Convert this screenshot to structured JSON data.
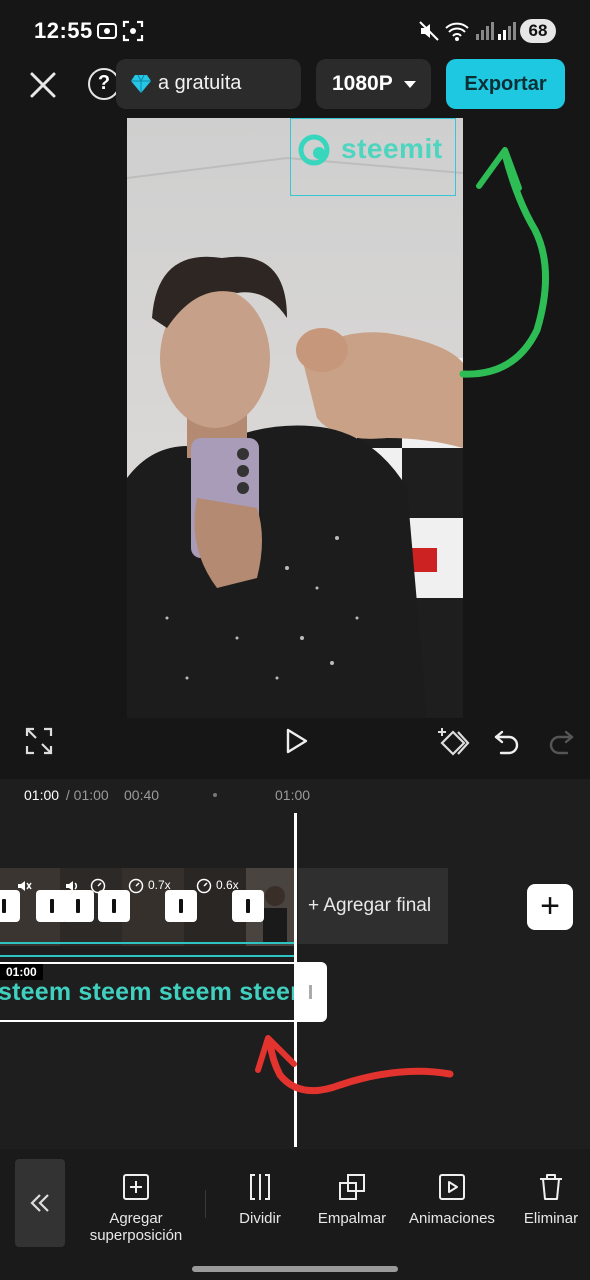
{
  "status_bar": {
    "time": "12:55",
    "battery": "68"
  },
  "top_bar": {
    "help_label": "?",
    "promo_label": "a gratuita",
    "resolution_label": "1080P",
    "export_label": "Exportar",
    "accent_color": "#1ec8e0"
  },
  "preview": {
    "watermark_text": "steemit"
  },
  "timeline": {
    "current_time": "01:00",
    "total_time": " / 01:00",
    "tick_mid": "00:40",
    "tick_end": "01:00",
    "speed_1": "0.7x",
    "speed_2": "0.6x",
    "add_end_label": "+ Agregar final",
    "text_track_time": "01:00",
    "text_track_content": "steem steem steem steem"
  },
  "toolbar": {
    "items": [
      {
        "label": "Agregar\nsuperposición",
        "icon": "add-overlay-icon"
      },
      {
        "label": "Dividir",
        "icon": "split-icon"
      },
      {
        "label": "Empalmar",
        "icon": "splice-icon"
      },
      {
        "label": "Animaciones",
        "icon": "animations-icon"
      },
      {
        "label": "Eliminar",
        "icon": "delete-icon"
      }
    ]
  }
}
